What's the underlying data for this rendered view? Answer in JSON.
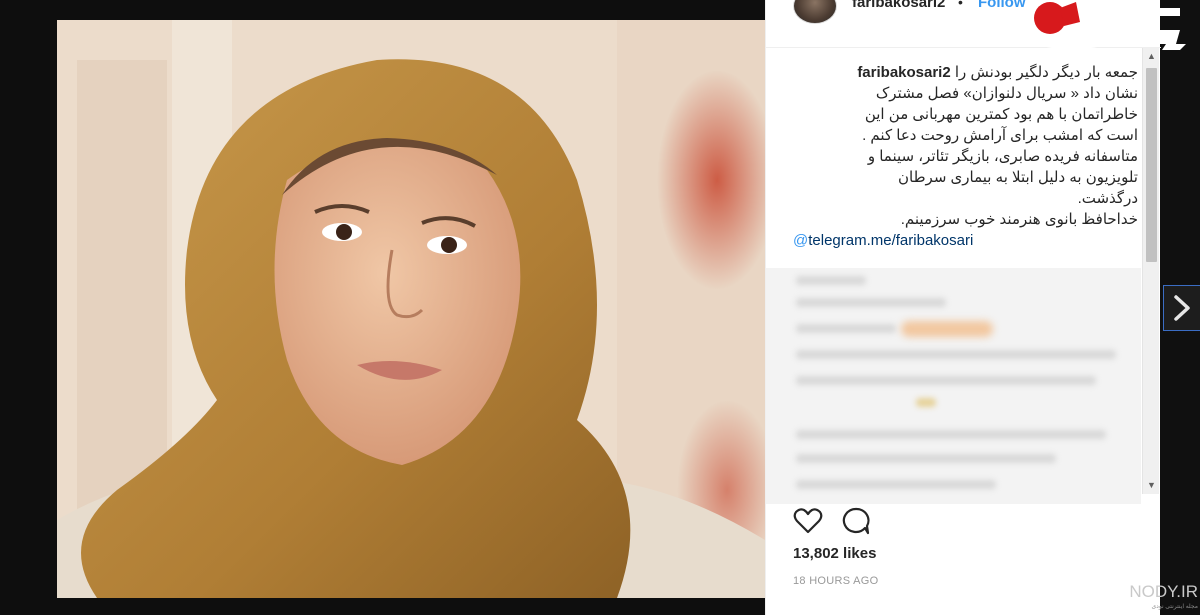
{
  "post": {
    "username": "faribakosari2",
    "separator": "•",
    "follow_label": "Follow",
    "caption": {
      "line_1": "جمعه بار دیگر دلگیر بودنش را",
      "line_2": "نشان داد « سریال دلنوازان» فصل مشترک",
      "line_3": "خاطراتمان با هم بود کمترین مهربانی من این",
      "line_4": "است که امشب برای آرامش روحت دعا کنم .",
      "line_5": "متاسفانه فریده صابری، بازیگر تئاتر، سینما و",
      "line_6": "تلویزیون به دلیل ابتلا به بیماری سرطان",
      "line_7": "درگذشت.",
      "line_8": "خداحافظ بانوی هنرمند خوب سرزمینم.",
      "link_at": "@",
      "link_text": "telegram.me/faribakosari"
    },
    "likes": "13,802 likes",
    "timestamp": "18 HOURS AGO"
  },
  "icons": {
    "like": "heart-icon",
    "comment": "comment-bubble-icon",
    "next": "chevron-right-icon",
    "scroll_up": "triangle-up-icon",
    "scroll_down": "triangle-down-icon"
  },
  "watermark": {
    "text": "NODY.IR",
    "subtext": "مجله اینترنتی نودی"
  },
  "colors": {
    "link_blue": "#3897f0",
    "text": "#262626",
    "muted": "#999999",
    "logo_red": "#d7191c",
    "headscarf": "#b98a3e"
  }
}
